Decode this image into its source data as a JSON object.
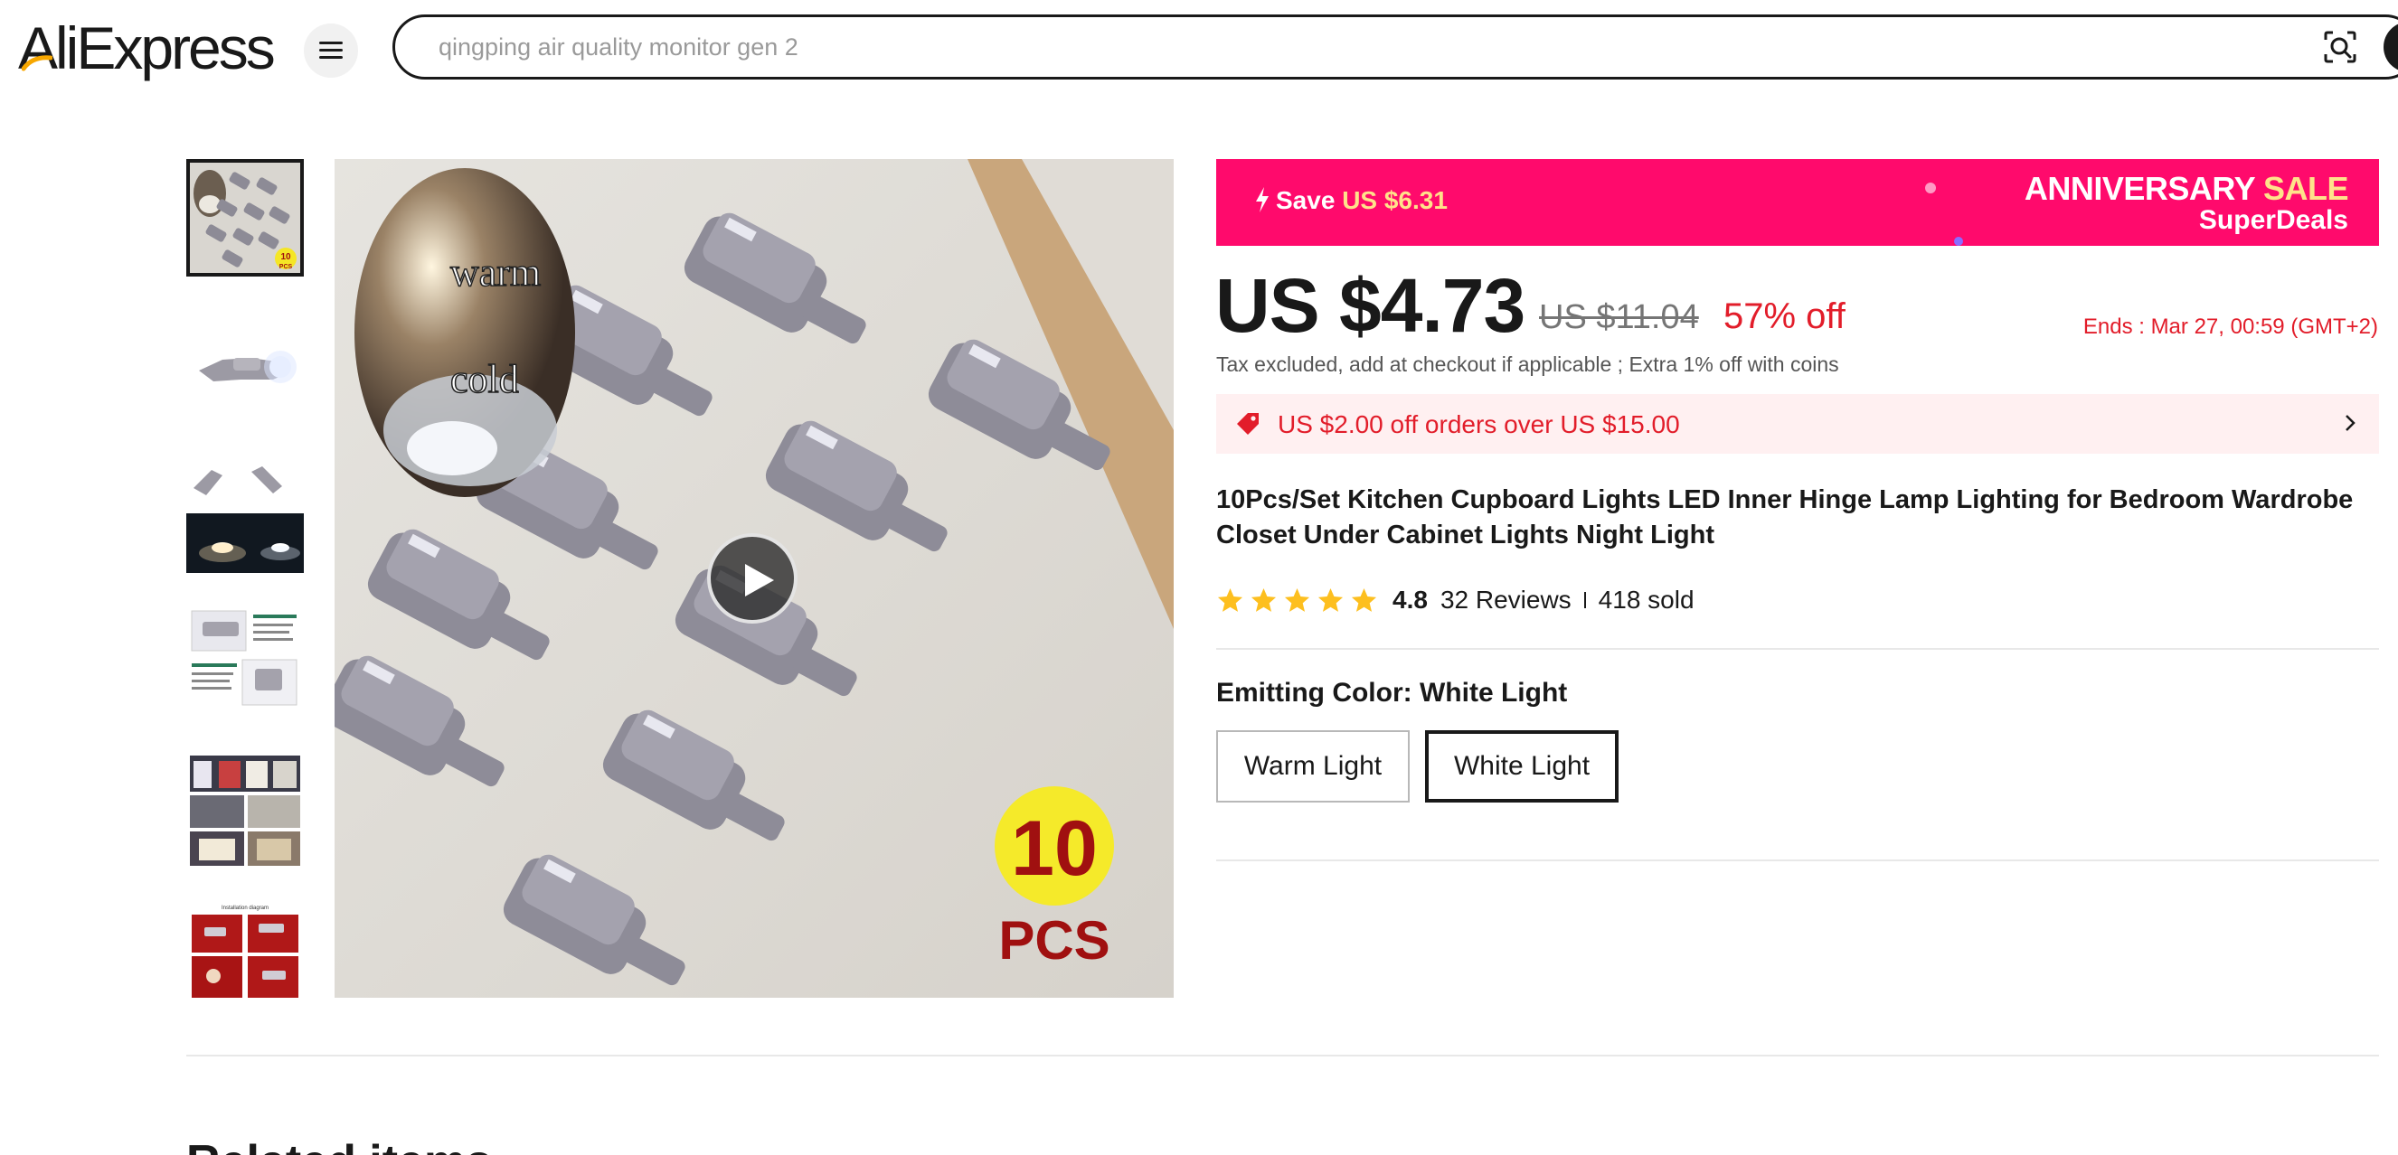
{
  "header": {
    "logo_text": "AliExpress",
    "search_placeholder": "qingping air quality monitor gen 2"
  },
  "gallery": {
    "thumbnails": [
      {
        "name": "10 pcs hinge lights",
        "badge_num": "10",
        "badge_unit": "PCS"
      },
      {
        "name": "single hinge light glowing"
      },
      {
        "name": "two hinge lights and night cabinet"
      },
      {
        "name": "product detail infographic"
      },
      {
        "name": "wardrobe installation photos"
      },
      {
        "name": "installation diagram",
        "caption": "Installation diagram"
      }
    ],
    "main_image": {
      "warm_label": "warm",
      "cold_label": "cold",
      "count_num": "10",
      "count_unit": "PCS"
    }
  },
  "promo": {
    "save_label": "Save",
    "save_amount": "US $6.31",
    "sale_word1": "ANNIVERSARY",
    "sale_word2": "SALE",
    "sale_line2": "SuperDeals",
    "bg_color": "#ff0a6c"
  },
  "pricing": {
    "price": "US $4.73",
    "original_price": "US $11.04",
    "discount": "57% off",
    "ends": "Ends :  Mar 27, 00:59 (GMT+2)",
    "tax_note": "Tax excluded, add at checkout if applicable ; Extra 1% off with coins",
    "coupon": "US $2.00 off orders over US $15.00",
    "accent_color": "#e21d2a"
  },
  "product": {
    "title": "10Pcs/Set Kitchen Cupboard Lights LED Inner Hinge Lamp Lighting for Bedroom Wardrobe Closet Under Cabinet Lights Night Light",
    "rating": "4.8",
    "stars": 5,
    "reviews": "32 Reviews",
    "sold": "418 sold"
  },
  "variants": {
    "label": "Emitting Color: ",
    "selected_value": "White Light",
    "options": [
      "Warm Light",
      "White Light"
    ],
    "selected_index": 1
  },
  "related": {
    "heading": "Related items"
  }
}
